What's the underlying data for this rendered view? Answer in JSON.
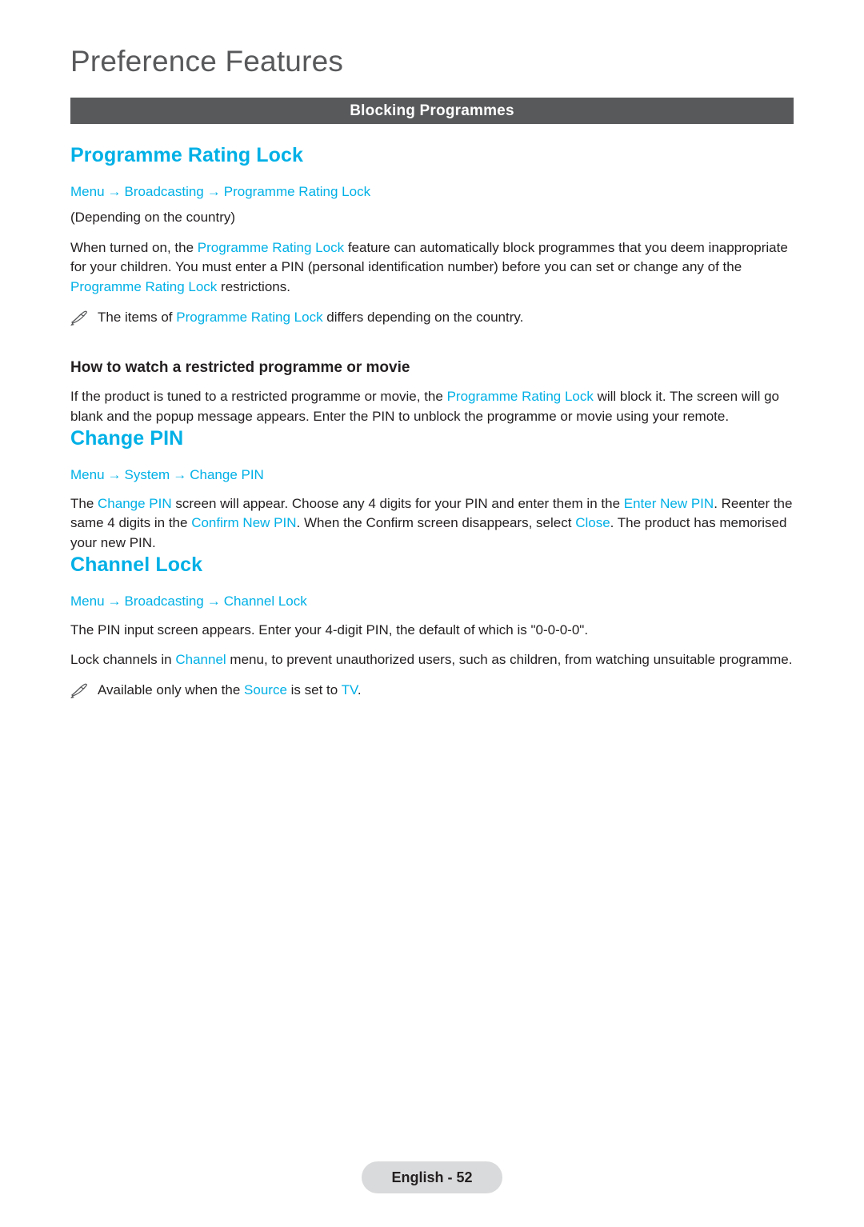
{
  "header": {
    "chapter_title": "Preference Features",
    "section_band": "Blocking Programmes"
  },
  "sections": [
    {
      "heading": "Programme Rating Lock",
      "breadcrumb": [
        "Menu",
        "Broadcasting",
        "Programme Rating Lock"
      ],
      "note_country": "(Depending on the country)",
      "body_1_a": "When turned on, the ",
      "body_1_b": "Programme Rating Lock",
      "body_1_c": " feature can automatically block programmes that you deem inappropriate for your children. You must enter a PIN (personal identification number) before you can set or change any of the ",
      "body_1_d": "Programme Rating Lock",
      "body_1_e": " restrictions.",
      "note_1_a": "The items of ",
      "note_1_b": "Programme Rating Lock",
      "note_1_c": " differs depending on the country.",
      "sub_heading": "How to watch a restricted programme or movie",
      "body_2_a": "If the product is tuned to a restricted programme or movie, the ",
      "body_2_b": "Programme Rating Lock",
      "body_2_c": " will block it. The screen will go blank and the popup message appears. Enter the PIN to unblock the programme or movie using your remote."
    },
    {
      "heading": "Change PIN",
      "breadcrumb": [
        "Menu",
        "System",
        "Change PIN"
      ],
      "body_1_a": "The ",
      "body_1_b": "Change PIN",
      "body_1_c": " screen will appear. Choose any 4 digits for your PIN and enter them in the ",
      "body_1_d": "Enter New PIN",
      "body_1_e": ". Reenter the same 4 digits in the ",
      "body_1_f": "Confirm New PIN",
      "body_1_g": ". When the Confirm screen disappears, select ",
      "body_1_h": "Close",
      "body_1_i": ". The product has memorised your new PIN."
    },
    {
      "heading": "Channel Lock",
      "breadcrumb": [
        "Menu",
        "Broadcasting",
        "Channel Lock"
      ],
      "body_1": "The PIN input screen appears. Enter your 4-digit PIN, the default of which is \"0-0-0-0\".",
      "body_2_a": "Lock channels in ",
      "body_2_b": "Channel",
      "body_2_c": " menu, to prevent unauthorized users, such as children, from watching unsuitable programme.",
      "note_1_a": "Available only when the ",
      "note_1_b": "Source",
      "note_1_c": " is set to ",
      "note_1_d": "TV",
      "note_1_e": "."
    }
  ],
  "footer": {
    "label": "English - 52"
  },
  "colors": {
    "accent": "#00b0e6",
    "band": "#58595b",
    "text": "#231f20",
    "footer_bg": "#d9dadb"
  },
  "icons": {
    "note": "pencil-note-icon",
    "arrow": "→"
  }
}
